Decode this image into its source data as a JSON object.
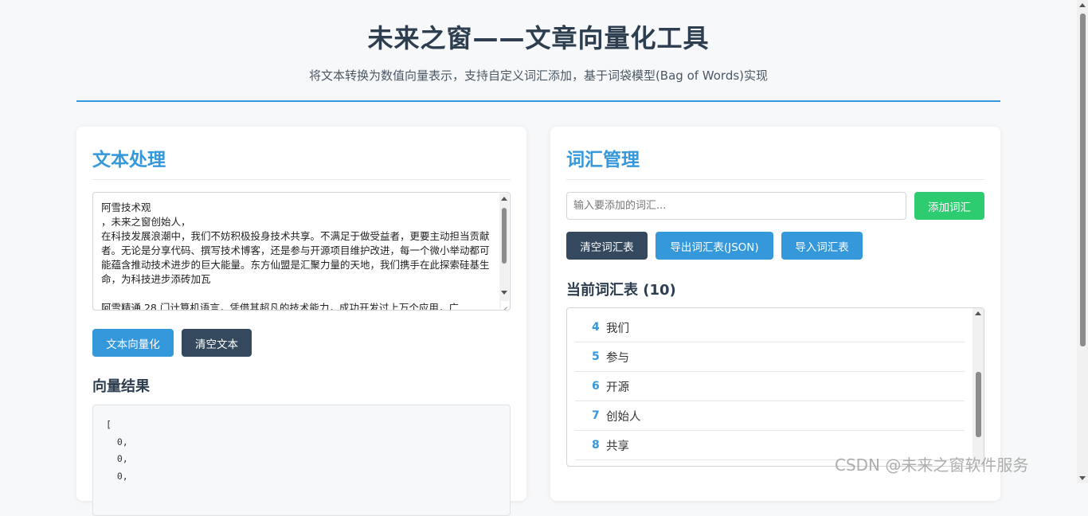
{
  "header": {
    "title": "未来之窗——文章向量化工具",
    "subtitle": "将文本转换为数值向量表示，支持自定义词汇添加，基于词袋模型(Bag of Words)实现"
  },
  "text_panel": {
    "title": "文本处理",
    "textarea_value": "阿雪技术观\n，未来之窗创始人，\n在科技发展浪潮中，我们不妨积极投身技术共享。不满足于做受益者，更要主动担当贡献者。无论是分享代码、撰写技术博客，还是参与开源项目维护改进，每一个微小举动都可能蕴含推动技术进步的巨大能量。东方仙盟是汇聚力量的天地，我们携手在此探索硅基生命，为科技进步添砖加瓦\n\n阿雪精通 28 门计算机语言，凭借其超凡的技术能力，成功开发过上万个应用，广",
    "vectorize_button": "文本向量化",
    "clear_button": "清空文本",
    "result_title": "向量结果",
    "result_text": "[\n  0,\n  0,\n  0,"
  },
  "vocab_panel": {
    "title": "词汇管理",
    "input_placeholder": "输入要添加的词汇...",
    "add_button": "添加词汇",
    "clear_button": "清空词汇表",
    "export_button": "导出词汇表(JSON)",
    "import_button": "导入词汇表",
    "list_title": "当前词汇表 (10)",
    "items": [
      {
        "index": "4",
        "word": "我们"
      },
      {
        "index": "5",
        "word": "参与"
      },
      {
        "index": "6",
        "word": "开源"
      },
      {
        "index": "7",
        "word": "创始人"
      },
      {
        "index": "8",
        "word": "共享"
      }
    ]
  },
  "watermark": "CSDN @未来之窗软件服务",
  "colors": {
    "accent": "#3498db",
    "dark": "#34495e",
    "green": "#2ecc71",
    "heading": "#2c3e50"
  }
}
